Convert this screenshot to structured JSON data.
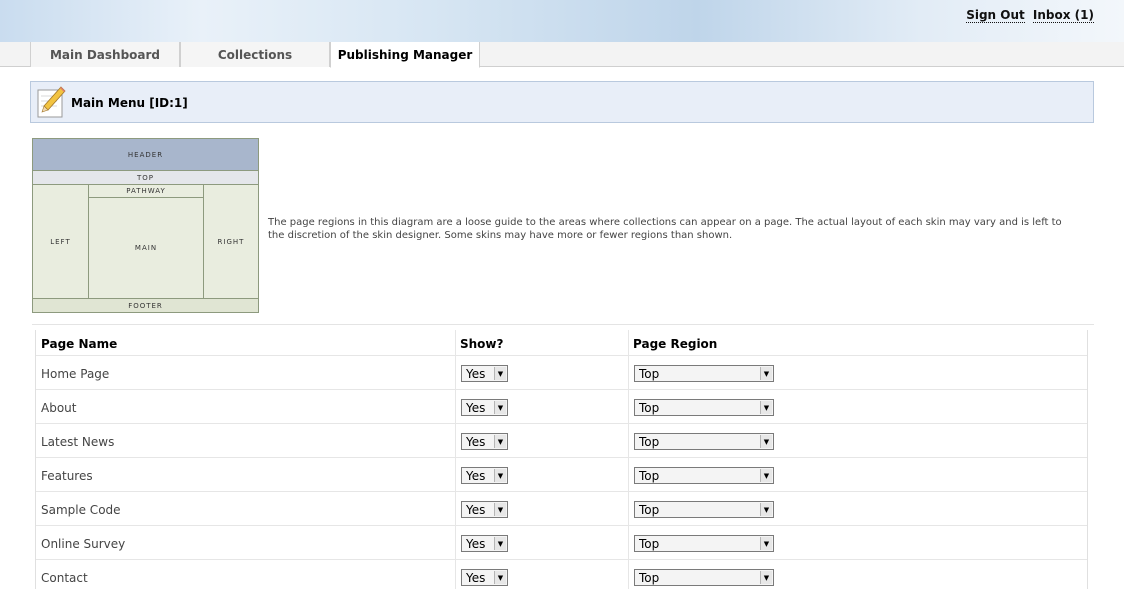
{
  "header": {
    "sign_out": "Sign Out",
    "inbox": "Inbox (1)"
  },
  "tabs": [
    {
      "label": "Main Dashboard",
      "active": false
    },
    {
      "label": "Collections",
      "active": false
    },
    {
      "label": "Publishing Manager",
      "active": true
    }
  ],
  "title": "Main Menu [ID:1]",
  "diagram": {
    "header": "HEADER",
    "top": "TOP",
    "pathway": "PATHWAY",
    "left": "LEFT",
    "main": "MAIN",
    "right": "RIGHT",
    "footer": "FOOTER"
  },
  "description": "The page regions in this diagram are a loose guide to the areas where collections can appear on a page. The actual layout of each skin may vary and is left to the discretion of the skin designer. Some skins may have more or fewer regions than shown.",
  "table": {
    "columns": [
      "Page Name",
      "Show?",
      "Page Region"
    ],
    "rows": [
      {
        "name": "Home Page",
        "show": "Yes",
        "region": "Top"
      },
      {
        "name": "About",
        "show": "Yes",
        "region": "Top"
      },
      {
        "name": "Latest News",
        "show": "Yes",
        "region": "Top"
      },
      {
        "name": "Features",
        "show": "Yes",
        "region": "Top"
      },
      {
        "name": "Sample Code",
        "show": "Yes",
        "region": "Top"
      },
      {
        "name": "Online Survey",
        "show": "Yes",
        "region": "Top"
      },
      {
        "name": "Contact",
        "show": "Yes",
        "region": "Top"
      }
    ]
  },
  "icons": {
    "title_icon": "pencil-icon",
    "dropdown_arrow": "chevron-down-icon"
  },
  "colors": {
    "title_panel_bg": "#e8eef8",
    "diagram_header": "#a8b6cc",
    "diagram_body": "#e9eddf"
  }
}
